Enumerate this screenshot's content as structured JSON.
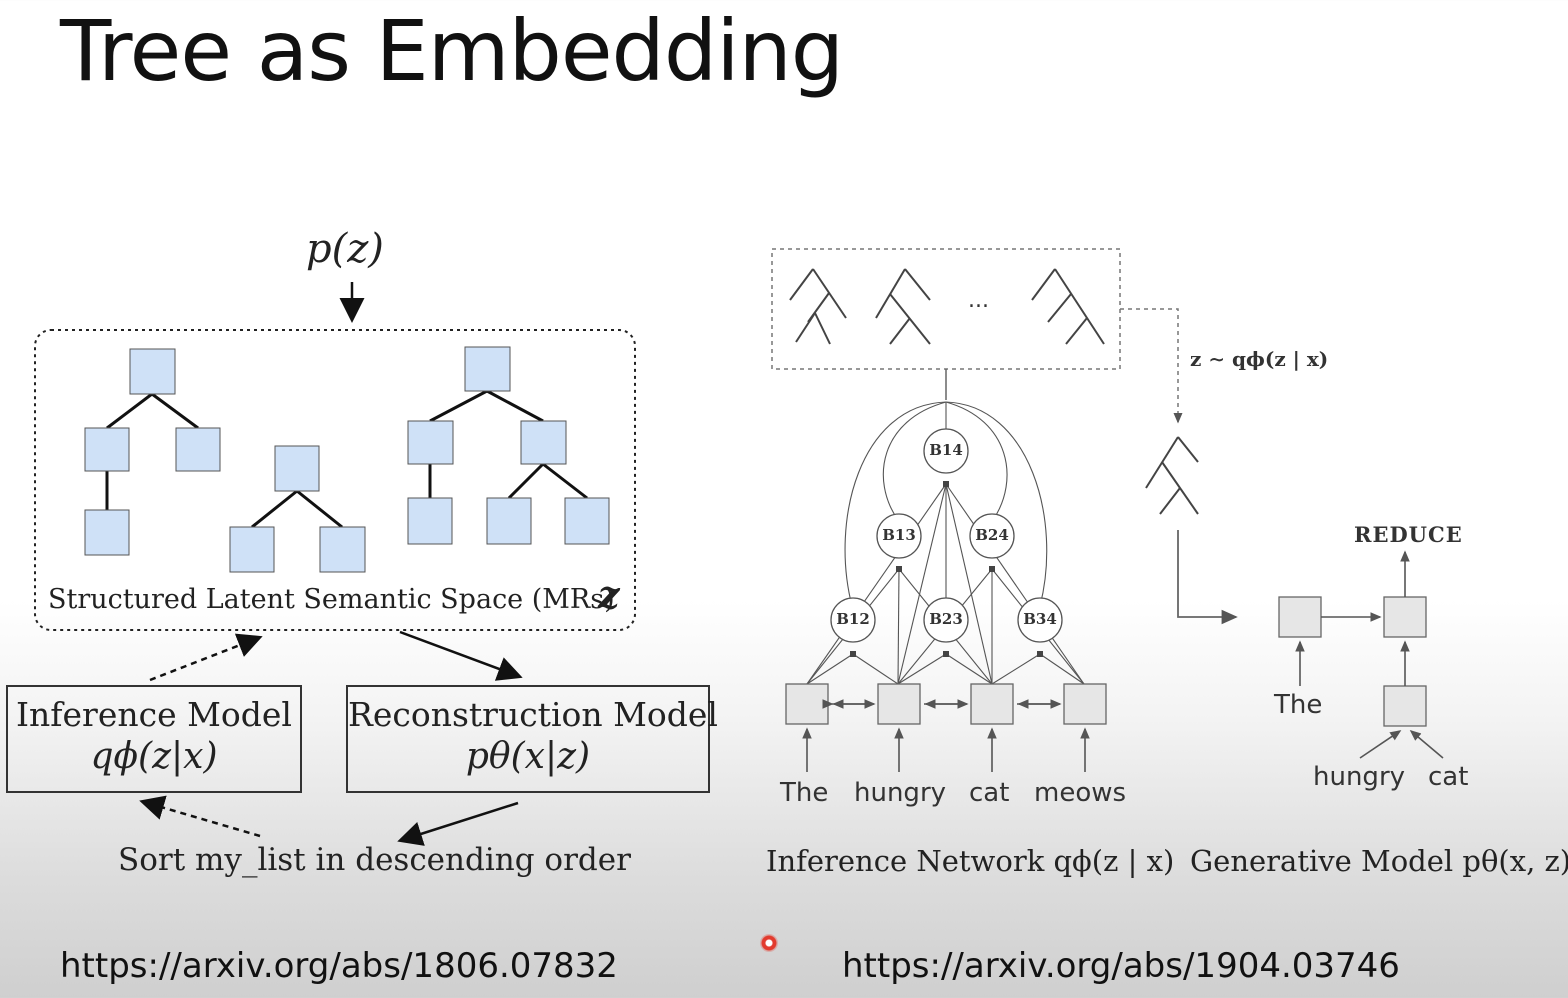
{
  "slide": {
    "title": "Tree as Embedding"
  },
  "left_diagram": {
    "prior": "p(z)",
    "latent_space_label": "Structured Latent Semantic Space (MRs)",
    "latent_symbol": "z",
    "inference_model": {
      "label": "Inference Model",
      "formula": "qϕ(z|x)"
    },
    "reconstruction_model": {
      "label": "Reconstruction Model",
      "formula": "pθ(x|z)"
    },
    "example_utterance": "Sort my_list in descending order",
    "url": "https://arxiv.org/abs/1806.07832"
  },
  "right_diagram": {
    "ellipsis": "...",
    "sample_label": "z ∼ qϕ(z | x)",
    "nodes": {
      "b14": "B14",
      "b13": "B13",
      "b24": "B24",
      "b12": "B12",
      "b23": "B23",
      "b34": "B34"
    },
    "words": [
      "The",
      "hungry",
      "cat",
      "meows"
    ],
    "inference_caption": "Inference Network qϕ(z | x)",
    "generative": {
      "action": "REDUCE",
      "word_the": "The",
      "word_hungry": "hungry",
      "word_cat": "cat",
      "caption": "Generative Model pθ(x, z)"
    },
    "url": "https://arxiv.org/abs/1904.03746"
  }
}
